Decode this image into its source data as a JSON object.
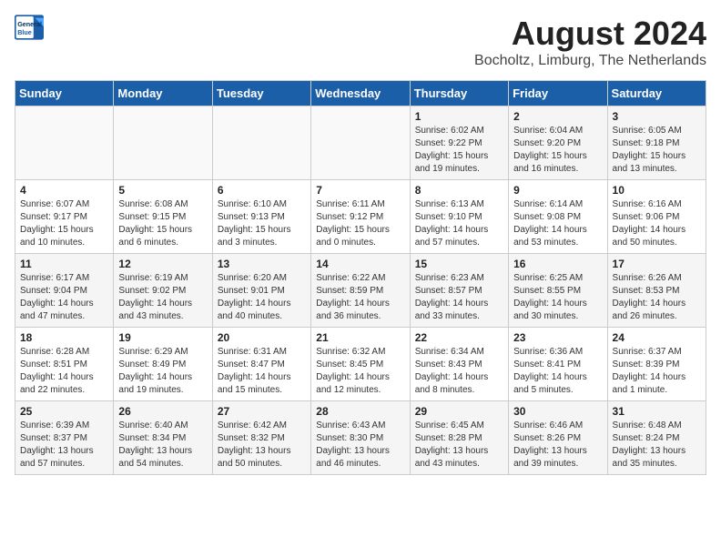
{
  "header": {
    "logo_line1": "General",
    "logo_line2": "Blue",
    "main_title": "August 2024",
    "subtitle": "Bocholtz, Limburg, The Netherlands"
  },
  "days_of_week": [
    "Sunday",
    "Monday",
    "Tuesday",
    "Wednesday",
    "Thursday",
    "Friday",
    "Saturday"
  ],
  "weeks": [
    [
      {
        "day": "",
        "info": ""
      },
      {
        "day": "",
        "info": ""
      },
      {
        "day": "",
        "info": ""
      },
      {
        "day": "",
        "info": ""
      },
      {
        "day": "1",
        "info": "Sunrise: 6:02 AM\nSunset: 9:22 PM\nDaylight: 15 hours\nand 19 minutes."
      },
      {
        "day": "2",
        "info": "Sunrise: 6:04 AM\nSunset: 9:20 PM\nDaylight: 15 hours\nand 16 minutes."
      },
      {
        "day": "3",
        "info": "Sunrise: 6:05 AM\nSunset: 9:18 PM\nDaylight: 15 hours\nand 13 minutes."
      }
    ],
    [
      {
        "day": "4",
        "info": "Sunrise: 6:07 AM\nSunset: 9:17 PM\nDaylight: 15 hours\nand 10 minutes."
      },
      {
        "day": "5",
        "info": "Sunrise: 6:08 AM\nSunset: 9:15 PM\nDaylight: 15 hours\nand 6 minutes."
      },
      {
        "day": "6",
        "info": "Sunrise: 6:10 AM\nSunset: 9:13 PM\nDaylight: 15 hours\nand 3 minutes."
      },
      {
        "day": "7",
        "info": "Sunrise: 6:11 AM\nSunset: 9:12 PM\nDaylight: 15 hours\nand 0 minutes."
      },
      {
        "day": "8",
        "info": "Sunrise: 6:13 AM\nSunset: 9:10 PM\nDaylight: 14 hours\nand 57 minutes."
      },
      {
        "day": "9",
        "info": "Sunrise: 6:14 AM\nSunset: 9:08 PM\nDaylight: 14 hours\nand 53 minutes."
      },
      {
        "day": "10",
        "info": "Sunrise: 6:16 AM\nSunset: 9:06 PM\nDaylight: 14 hours\nand 50 minutes."
      }
    ],
    [
      {
        "day": "11",
        "info": "Sunrise: 6:17 AM\nSunset: 9:04 PM\nDaylight: 14 hours\nand 47 minutes."
      },
      {
        "day": "12",
        "info": "Sunrise: 6:19 AM\nSunset: 9:02 PM\nDaylight: 14 hours\nand 43 minutes."
      },
      {
        "day": "13",
        "info": "Sunrise: 6:20 AM\nSunset: 9:01 PM\nDaylight: 14 hours\nand 40 minutes."
      },
      {
        "day": "14",
        "info": "Sunrise: 6:22 AM\nSunset: 8:59 PM\nDaylight: 14 hours\nand 36 minutes."
      },
      {
        "day": "15",
        "info": "Sunrise: 6:23 AM\nSunset: 8:57 PM\nDaylight: 14 hours\nand 33 minutes."
      },
      {
        "day": "16",
        "info": "Sunrise: 6:25 AM\nSunset: 8:55 PM\nDaylight: 14 hours\nand 30 minutes."
      },
      {
        "day": "17",
        "info": "Sunrise: 6:26 AM\nSunset: 8:53 PM\nDaylight: 14 hours\nand 26 minutes."
      }
    ],
    [
      {
        "day": "18",
        "info": "Sunrise: 6:28 AM\nSunset: 8:51 PM\nDaylight: 14 hours\nand 22 minutes."
      },
      {
        "day": "19",
        "info": "Sunrise: 6:29 AM\nSunset: 8:49 PM\nDaylight: 14 hours\nand 19 minutes."
      },
      {
        "day": "20",
        "info": "Sunrise: 6:31 AM\nSunset: 8:47 PM\nDaylight: 14 hours\nand 15 minutes."
      },
      {
        "day": "21",
        "info": "Sunrise: 6:32 AM\nSunset: 8:45 PM\nDaylight: 14 hours\nand 12 minutes."
      },
      {
        "day": "22",
        "info": "Sunrise: 6:34 AM\nSunset: 8:43 PM\nDaylight: 14 hours\nand 8 minutes."
      },
      {
        "day": "23",
        "info": "Sunrise: 6:36 AM\nSunset: 8:41 PM\nDaylight: 14 hours\nand 5 minutes."
      },
      {
        "day": "24",
        "info": "Sunrise: 6:37 AM\nSunset: 8:39 PM\nDaylight: 14 hours\nand 1 minute."
      }
    ],
    [
      {
        "day": "25",
        "info": "Sunrise: 6:39 AM\nSunset: 8:37 PM\nDaylight: 13 hours\nand 57 minutes."
      },
      {
        "day": "26",
        "info": "Sunrise: 6:40 AM\nSunset: 8:34 PM\nDaylight: 13 hours\nand 54 minutes."
      },
      {
        "day": "27",
        "info": "Sunrise: 6:42 AM\nSunset: 8:32 PM\nDaylight: 13 hours\nand 50 minutes."
      },
      {
        "day": "28",
        "info": "Sunrise: 6:43 AM\nSunset: 8:30 PM\nDaylight: 13 hours\nand 46 minutes."
      },
      {
        "day": "29",
        "info": "Sunrise: 6:45 AM\nSunset: 8:28 PM\nDaylight: 13 hours\nand 43 minutes."
      },
      {
        "day": "30",
        "info": "Sunrise: 6:46 AM\nSunset: 8:26 PM\nDaylight: 13 hours\nand 39 minutes."
      },
      {
        "day": "31",
        "info": "Sunrise: 6:48 AM\nSunset: 8:24 PM\nDaylight: 13 hours\nand 35 minutes."
      }
    ]
  ]
}
